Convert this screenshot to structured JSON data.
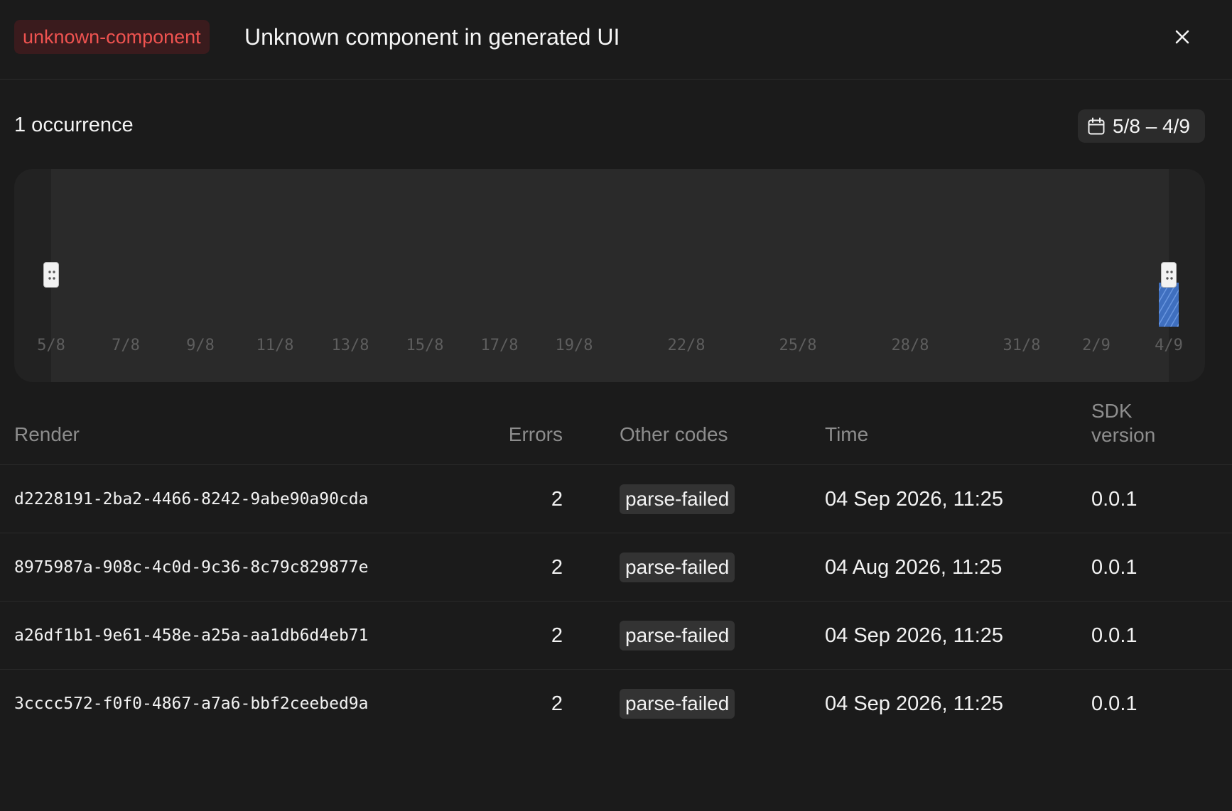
{
  "header": {
    "code_badge": "unknown-component",
    "title": "Unknown component in generated UI"
  },
  "summary": {
    "occurrences": "1 occurrence",
    "date_range": "5/8 – 4/9"
  },
  "timeline": {
    "tick_labels": [
      "5/8",
      "7/8",
      "9/8",
      "11/8",
      "13/8",
      "15/8",
      "17/8",
      "19/8",
      "22/8",
      "25/8",
      "28/8",
      "31/8",
      "2/9",
      "4/9"
    ],
    "bar_color": "#3f6fbf",
    "bar_stripe_color": "#6a97e0"
  },
  "chart_data": {
    "type": "bar",
    "categories": [
      "4/9"
    ],
    "values": [
      1
    ],
    "title": "",
    "xlabel": "",
    "ylabel": "",
    "x_range": [
      "5/8",
      "4/9"
    ]
  },
  "table": {
    "columns": {
      "render": "Render",
      "errors": "Errors",
      "other_codes": "Other codes",
      "time": "Time",
      "sdk_line1": "SDK",
      "sdk_line2": "version"
    },
    "rows": [
      {
        "render": "d2228191-2ba2-4466-8242-9abe90a90cda",
        "errors": "2",
        "code": "parse-failed",
        "time": "04 Sep 2026, 11:25",
        "sdk": "0.0.1"
      },
      {
        "render": "8975987a-908c-4c0d-9c36-8c79c829877e",
        "errors": "2",
        "code": "parse-failed",
        "time": "04 Aug 2026, 11:25",
        "sdk": "0.0.1"
      },
      {
        "render": "a26df1b1-9e61-458e-a25a-aa1db6d4eb71",
        "errors": "2",
        "code": "parse-failed",
        "time": "04 Sep 2026, 11:25",
        "sdk": "0.0.1"
      },
      {
        "render": "3cccc572-f0f0-4867-a7a6-bbf2ceebed9a",
        "errors": "2",
        "code": "parse-failed",
        "time": "04 Sep 2026, 11:25",
        "sdk": "0.0.1"
      }
    ]
  },
  "colors": {
    "background": "#1b1b1b",
    "badge_text": "#ef5350",
    "badge_bg": "#3a1b1d"
  }
}
